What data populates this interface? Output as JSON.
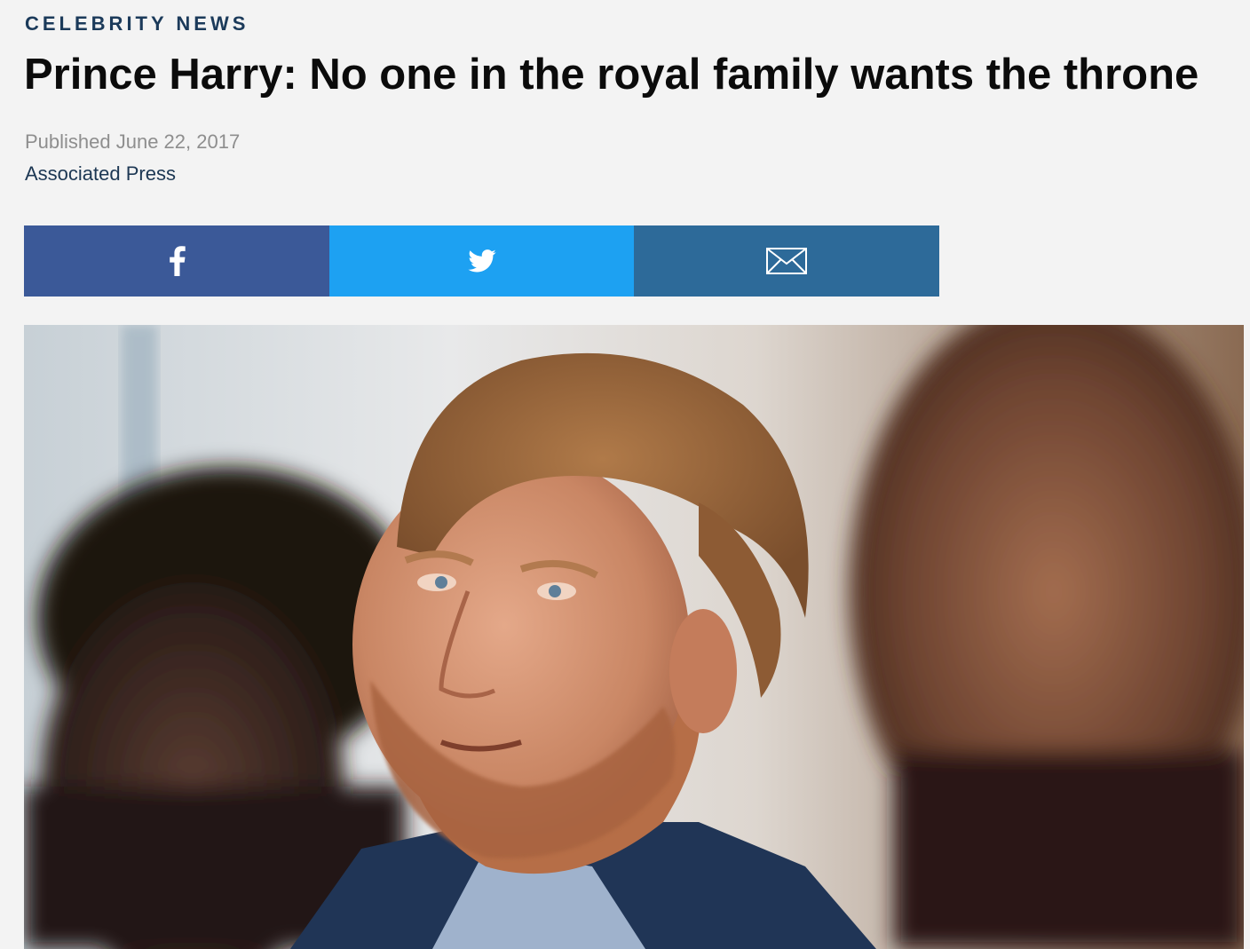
{
  "article": {
    "category": "CELEBRITY NEWS",
    "headline": "Prince Harry: No one in the royal family wants the throne",
    "published": "Published June 22, 2017",
    "author": "Associated Press"
  },
  "share": {
    "buttons": [
      {
        "network": "facebook",
        "icon": "facebook-icon",
        "color": "#3b5998"
      },
      {
        "network": "twitter",
        "icon": "twitter-icon",
        "color": "#1da1f2"
      },
      {
        "network": "email",
        "icon": "email-icon",
        "color": "#2d6a99"
      }
    ]
  },
  "hero_image": {
    "subject": "photo-prince-harry"
  },
  "colors": {
    "background": "#f3f3f3",
    "kicker": "#1b3a5a",
    "author": "#1c3753",
    "published": "#8e8e8e"
  }
}
